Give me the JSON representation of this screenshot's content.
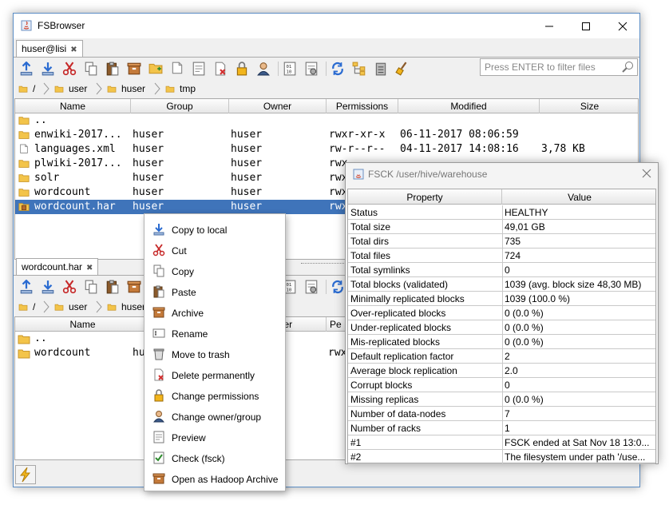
{
  "window": {
    "title": "FSBrowser"
  },
  "top_panel": {
    "tab": "huser@lisi",
    "filter_placeholder": "Press ENTER to filter files",
    "breadcrumb": [
      "/",
      "user",
      "huser",
      "tmp"
    ],
    "columns": [
      "Name",
      "Group",
      "Owner",
      "Permissions",
      "Modified",
      "Size"
    ],
    "rows": [
      {
        "name": "..",
        "group": "",
        "owner": "",
        "perms": "",
        "modified": "",
        "size": "",
        "icon": "folder-icon"
      },
      {
        "name": "enwiki-2017...",
        "group": "huser",
        "owner": "huser",
        "perms": "rwxr-xr-x",
        "modified": "06-11-2017 08:06:59",
        "size": "",
        "icon": "folder-icon"
      },
      {
        "name": "languages.xml",
        "group": "huser",
        "owner": "huser",
        "perms": "rw-r--r--",
        "modified": "04-11-2017 14:08:16",
        "size": "3,78 KB",
        "icon": "file-icon"
      },
      {
        "name": "plwiki-2017...",
        "group": "huser",
        "owner": "huser",
        "perms": "rwx",
        "modified": "",
        "size": "",
        "icon": "folder-icon"
      },
      {
        "name": "solr",
        "group": "huser",
        "owner": "huser",
        "perms": "rwx",
        "modified": "",
        "size": "",
        "icon": "folder-icon"
      },
      {
        "name": "wordcount",
        "group": "huser",
        "owner": "huser",
        "perms": "rwx",
        "modified": "",
        "size": "",
        "icon": "folder-icon"
      },
      {
        "name": "wordcount.har",
        "group": "huser",
        "owner": "huser",
        "perms": "rwx",
        "modified": "",
        "size": "",
        "icon": "archive-icon"
      }
    ]
  },
  "bottom_panel": {
    "tab": "wordcount.har",
    "breadcrumb": [
      "/",
      "user",
      "huser",
      "wordcount.har"
    ],
    "columns": [
      "Name",
      "Owner",
      "Pe"
    ],
    "rows": [
      {
        "name": "..",
        "owner": "",
        "perms": ""
      },
      {
        "name": "wordcount",
        "group": "hus",
        "owner": "huser",
        "perms": "rwx"
      }
    ]
  },
  "context_menu": [
    {
      "label": "Copy to local",
      "icon": "download-icon"
    },
    {
      "label": "Cut",
      "icon": "scissors-icon"
    },
    {
      "label": "Copy",
      "icon": "copy-icon"
    },
    {
      "label": "Paste",
      "icon": "paste-icon"
    },
    {
      "label": "Archive",
      "icon": "archive-box-icon"
    },
    {
      "label": "Rename",
      "icon": "rename-icon"
    },
    {
      "label": "Move to trash",
      "icon": "trash-icon"
    },
    {
      "label": "Delete permanently",
      "icon": "delete-icon"
    },
    {
      "label": "Change permissions",
      "icon": "lock-icon"
    },
    {
      "label": "Change owner/group",
      "icon": "user-icon"
    },
    {
      "label": "Preview",
      "icon": "preview-icon"
    },
    {
      "label": "Check (fsck)",
      "icon": "check-icon"
    },
    {
      "label": "Open as Hadoop Archive",
      "icon": "archive-box-icon"
    }
  ],
  "fsck_dialog": {
    "title": "FSCK /user/hive/warehouse",
    "columns": [
      "Property",
      "Value"
    ],
    "rows": [
      {
        "property": "Status",
        "value": "HEALTHY"
      },
      {
        "property": "Total size",
        "value": "49,01 GB"
      },
      {
        "property": "Total dirs",
        "value": "735"
      },
      {
        "property": "Total files",
        "value": "724"
      },
      {
        "property": "Total symlinks",
        "value": "0"
      },
      {
        "property": "Total blocks (validated)",
        "value": "1039 (avg. block size 48,30 MB)"
      },
      {
        "property": "Minimally replicated blocks",
        "value": "1039 (100.0 %)"
      },
      {
        "property": "Over-replicated blocks",
        "value": "0 (0.0 %)"
      },
      {
        "property": "Under-replicated blocks",
        "value": "0 (0.0 %)"
      },
      {
        "property": "Mis-replicated blocks",
        "value": "0 (0.0 %)"
      },
      {
        "property": "Default replication factor",
        "value": "2"
      },
      {
        "property": "Average block replication",
        "value": "2.0"
      },
      {
        "property": "Corrupt blocks",
        "value": "0"
      },
      {
        "property": "Missing replicas",
        "value": "0 (0.0 %)"
      },
      {
        "property": "Number of data-nodes",
        "value": "7"
      },
      {
        "property": "Number of racks",
        "value": "1"
      },
      {
        "property": "#1",
        "value": "FSCK ended at Sat Nov 18 13:0..."
      },
      {
        "property": "#2",
        "value": "The filesystem under path '/use..."
      }
    ]
  },
  "colors": {
    "selection": "#3f74ba",
    "folder": "#f3c44a",
    "window_border": "#5b8dc5"
  }
}
